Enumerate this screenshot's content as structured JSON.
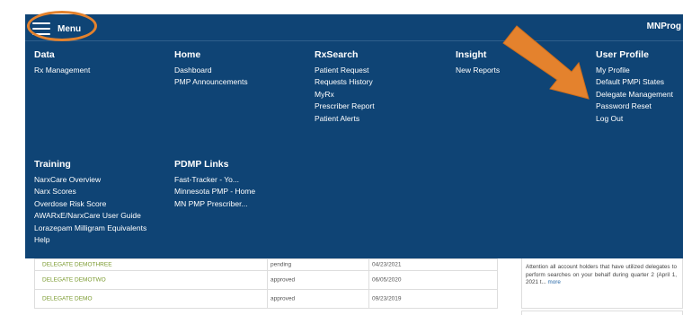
{
  "header": {
    "menu_label": "Menu",
    "brand": "MNProg"
  },
  "menu": {
    "data": {
      "heading": "Data",
      "items": [
        "Rx Management"
      ]
    },
    "home": {
      "heading": "Home",
      "items": [
        "Dashboard",
        "PMP Announcements"
      ]
    },
    "rxsearch": {
      "heading": "RxSearch",
      "items": [
        "Patient Request",
        "Requests History",
        "MyRx",
        "Prescriber Report",
        "Patient Alerts"
      ]
    },
    "insight": {
      "heading": "Insight",
      "items": [
        "New Reports"
      ]
    },
    "user_profile": {
      "heading": "User Profile",
      "items": [
        "My Profile",
        "Default PMPi States",
        "Delegate Management",
        "Password Reset",
        "Log Out"
      ]
    },
    "training": {
      "heading": "Training",
      "items": [
        "NarxCare Overview",
        "Narx Scores",
        "Overdose Risk Score",
        "AWARxE/NarxCare User Guide",
        "Lorazepam Milligram Equivalents",
        "Help"
      ]
    },
    "pdmp_links": {
      "heading": "PDMP Links",
      "items": [
        "Fast-Tracker - Yo...",
        "Minnesota PMP - Home",
        "MN PMP Prescriber..."
      ]
    }
  },
  "delegates": {
    "rows": [
      {
        "name": "DELEGATE DEMOTHREE",
        "status": "pending",
        "date": "04/23/2021"
      },
      {
        "name": "DELEGATE DEMOTWO",
        "status": "approved",
        "date": "06/05/2020"
      },
      {
        "name": "DELEGATE DEMO",
        "status": "approved",
        "date": "09/23/2019"
      }
    ]
  },
  "announcement": {
    "text": "Attention all account holders that have utilized delegates to perform searches on your behalf during quarter 2 (April 1, 2021 t...",
    "more_label": "more"
  },
  "colors": {
    "nav_background": "#0f4475",
    "annotation_orange": "#e4822d",
    "delegate_name": "#7a9a2e"
  },
  "icons": {
    "menu_toggle": "hamburger-icon",
    "annotation": "arrow-icon"
  }
}
